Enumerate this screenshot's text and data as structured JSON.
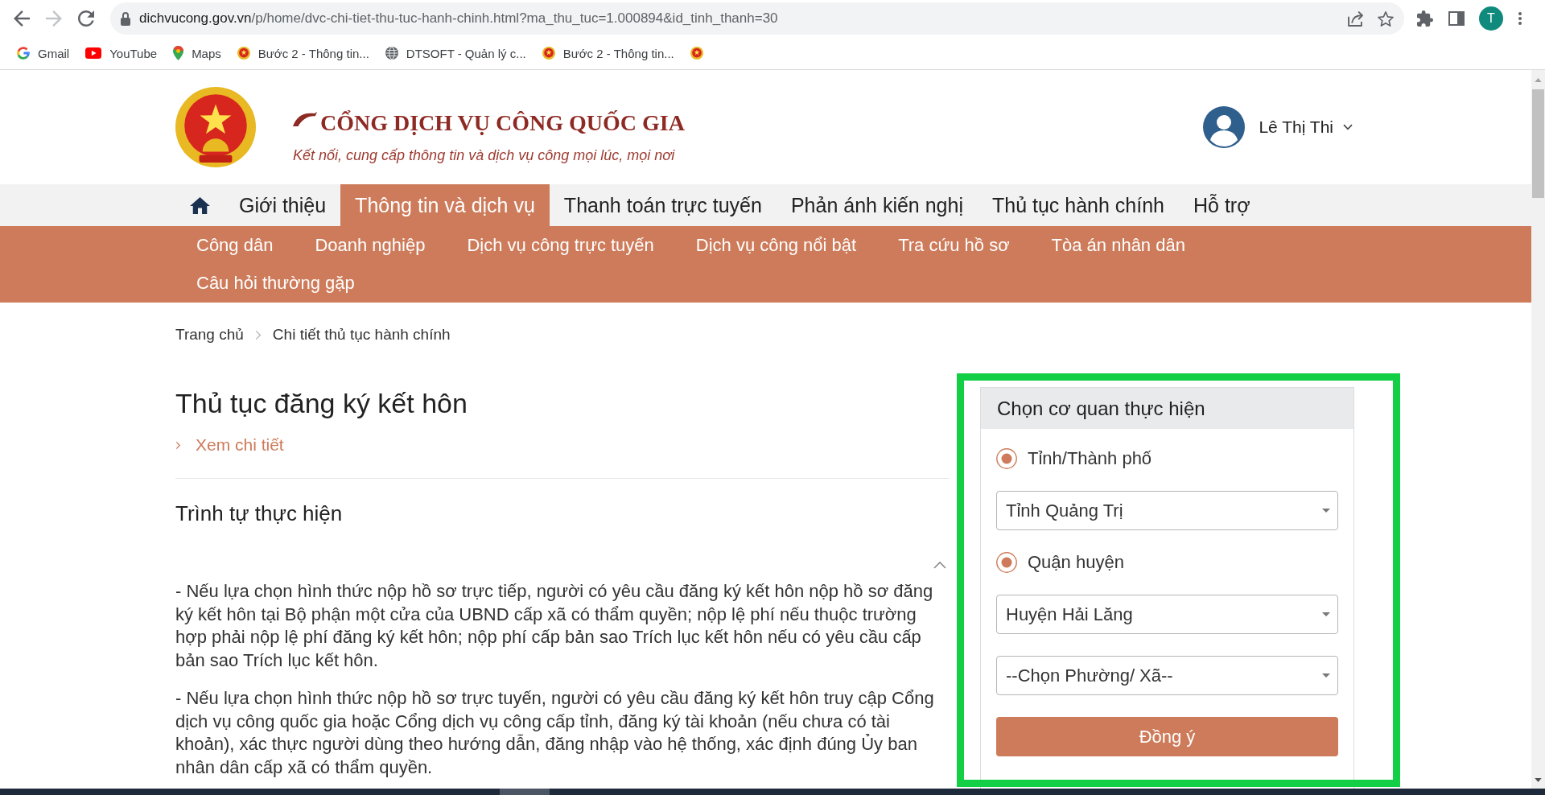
{
  "browser": {
    "nav_buttons": [
      {
        "kind": "back",
        "disabled": false
      },
      {
        "kind": "forward",
        "disabled": true
      },
      {
        "kind": "reload",
        "disabled": false
      }
    ],
    "address": {
      "host": "dichvucong.gov.vn",
      "path": "/p/home/dvc-chi-tiet-thu-tuc-hanh-chinh.html?ma_thu_tuc=1.000894&id_tinh_thanh=30"
    },
    "profile_initial": "T",
    "bookmarks": [
      {
        "kind": "google",
        "label": "Gmail"
      },
      {
        "kind": "youtube",
        "label": "YouTube"
      },
      {
        "kind": "maps",
        "label": "Maps"
      },
      {
        "kind": "emblem",
        "label": "Bước 2 - Thông tin..."
      },
      {
        "kind": "globe",
        "label": "DTSOFT - Quản lý c..."
      },
      {
        "kind": "emblem",
        "label": "Bước 2 - Thông tin..."
      },
      {
        "kind": "emblem"
      }
    ]
  },
  "site": {
    "title": "CỔNG DỊCH VỤ CÔNG QUỐC GIA",
    "tagline": "Kết nối, cung cấp thông tin và dịch vụ công mọi lúc, mọi nơi",
    "user": {
      "name": "Lê Thị Thi"
    }
  },
  "main_menu": [
    {
      "kind": "home",
      "selected": false
    },
    {
      "kind": "text",
      "label": "Giới thiệu",
      "selected": false
    },
    {
      "kind": "text",
      "label": "Thông tin và dịch vụ",
      "selected": true
    },
    {
      "kind": "text",
      "label": "Thanh toán trực tuyến",
      "selected": false
    },
    {
      "kind": "text",
      "label": "Phản ánh kiến nghị",
      "selected": false
    },
    {
      "kind": "text",
      "label": "Thủ tục hành chính",
      "selected": false
    },
    {
      "kind": "text",
      "label": "Hỗ trợ",
      "selected": false
    }
  ],
  "sub_menu": [
    "Công dân",
    "Doanh nghiệp",
    "Dịch vụ công trực tuyến",
    "Dịch vụ công nổi bật",
    "Tra cứu hồ sơ",
    "Tòa án nhân dân",
    "Câu hỏi thường gặp"
  ],
  "breadcrumb": [
    "Trang chủ",
    "Chi tiết thủ tục hành chính"
  ],
  "procedure": {
    "title": "Thủ tục đăng ký kết hôn",
    "detail_link": "Xem chi tiết",
    "sections": [
      {
        "heading": "Trình tự thực hiện",
        "expanded": true,
        "paragraphs": [
          "- Nếu lựa chọn hình thức nộp hồ sơ trực tiếp, người có yêu cầu đăng ký kết hôn nộp hồ sơ đăng ký kết hôn tại Bộ phận một cửa của UBND cấp xã có thẩm quyền; nộp lệ phí nếu thuộc trường hợp phải nộp lệ phí đăng ký kết hôn; nộp phí cấp bản sao Trích lục kết hôn nếu có yêu cầu cấp bản sao Trích lục kết hôn.",
          "- Nếu lựa chọn hình thức nộp hồ sơ trực tuyến, người có yêu cầu đăng ký kết hôn truy cập Cổng dịch vụ công quốc gia hoặc Cổng dịch vụ công cấp tỉnh, đăng ký tài khoản (nếu chưa có tài khoản), xác thực người dùng theo hướng dẫn, đăng nhập vào hệ thống, xác định đúng Ủy ban nhân dân cấp xã có thẩm quyền."
        ]
      }
    ]
  },
  "agency_panel": {
    "highlighted": true,
    "title": "Chọn cơ quan thực hiện",
    "fields": [
      {
        "kind": "radio",
        "label": "Tỉnh/Thành phố",
        "checked": true
      },
      {
        "kind": "select",
        "value": "Tỉnh Quảng Trị"
      },
      {
        "kind": "radio",
        "label": "Quận huyện",
        "checked": true
      },
      {
        "kind": "select",
        "value": "Huyện Hải Lăng"
      },
      {
        "kind": "select",
        "value": "--Chọn Phường/ Xã--"
      }
    ],
    "submit": "Đồng ý"
  }
}
